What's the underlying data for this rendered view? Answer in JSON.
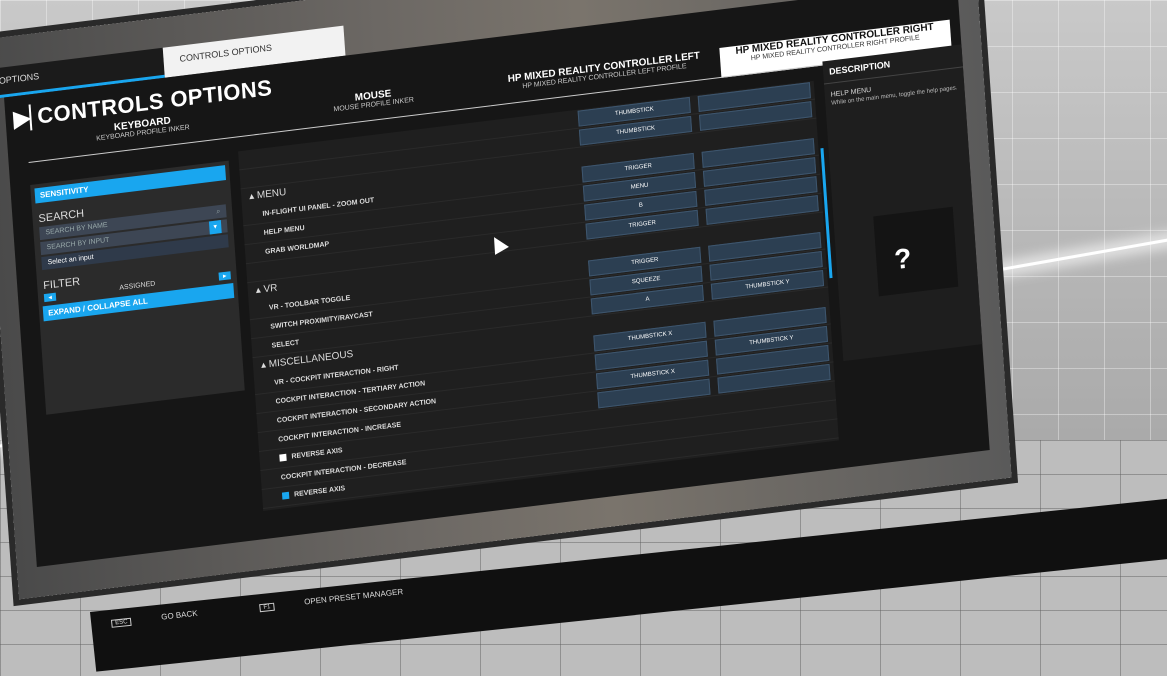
{
  "topbar": {
    "icons": [
      "settings-icon",
      "profile-icon",
      "user-icon",
      "active-icon"
    ]
  },
  "tabs": [
    {
      "label": "OPTIONS"
    },
    {
      "label": "CONTROLS OPTIONS"
    }
  ],
  "page_title": "CONTROLS OPTIONS",
  "profiles": [
    {
      "name": "KEYBOARD",
      "sub": "KEYBOARD PROFILE INKER"
    },
    {
      "name": "MOUSE",
      "sub": "MOUSE PROFILE INKER"
    },
    {
      "name": "HP MIXED REALITY CONTROLLER LEFT",
      "sub": "HP MIXED REALITY CONTROLLER LEFT PROFILE"
    },
    {
      "name": "HP MIXED REALITY CONTROLLER RIGHT",
      "sub": "HP MIXED REALITY CONTROLLER RIGHT PROFILE"
    }
  ],
  "left": {
    "sensitivity": "SENSITIVITY",
    "search_label": "SEARCH",
    "search_by_name": "SEARCH BY NAME",
    "search_by_input": "SEARCH BY INPUT",
    "select_input": "Select an input",
    "filter_label": "FILTER",
    "assigned": "ASSIGNED",
    "expand": "EXPAND / COLLAPSE ALL"
  },
  "table": {
    "top_rows": [
      {
        "c1": "THUMBSTICK",
        "c2": ""
      },
      {
        "c1": "THUMBSTICK",
        "c2": ""
      },
      {
        "c1": "TRIGGER",
        "c2": ""
      }
    ],
    "sections": {
      "menu": "MENU",
      "vr": "VR",
      "misc": "MISCELLANEOUS"
    },
    "menu_rows": [
      {
        "label": "IN-FLIGHT UI PANEL - ZOOM OUT",
        "c1": "",
        "c2": ""
      },
      {
        "label": "HELP MENU",
        "c1": "MENU",
        "c2": ""
      },
      {
        "label": "GRAB WORLDMAP",
        "c1": "B",
        "c2": ""
      },
      {
        "label": "",
        "c1": "TRIGGER",
        "c2": ""
      }
    ],
    "vr_rows": [
      {
        "label": "VR - TOOLBAR TOGGLE",
        "c1": "TRIGGER",
        "c2": ""
      },
      {
        "label": "SWITCH PROXIMITY/RAYCAST",
        "c1": "SQUEEZE",
        "c2": ""
      },
      {
        "label": "SELECT",
        "c1": "A",
        "c2": "THUMBSTICK Y"
      }
    ],
    "misc_rows": [
      {
        "label": "VR - COCKPIT INTERACTION - RIGHT",
        "c1": "THUMBSTICK X",
        "c2": ""
      },
      {
        "label": "COCKPIT INTERACTION - TERTIARY ACTION",
        "c1": "",
        "c2": "THUMBSTICK Y"
      },
      {
        "label": "COCKPIT INTERACTION - SECONDARY ACTION",
        "c1": "THUMBSTICK X",
        "c2": ""
      },
      {
        "label": "COCKPIT INTERACTION - INCREASE",
        "c1": "",
        "c2": ""
      }
    ],
    "reverse_axis": "REVERSE AXIS",
    "decrease_label": "COCKPIT INTERACTION - DECREASE"
  },
  "description": {
    "title": "DESCRIPTION",
    "heading": "HELP MENU",
    "text": "While on the main menu, toggle the help pages.",
    "icon": "help-icon"
  },
  "footer": {
    "go_back_key": "ESC",
    "go_back": "GO BACK",
    "preset_key": "F1",
    "preset": "OPEN PRESET MANAGER"
  }
}
